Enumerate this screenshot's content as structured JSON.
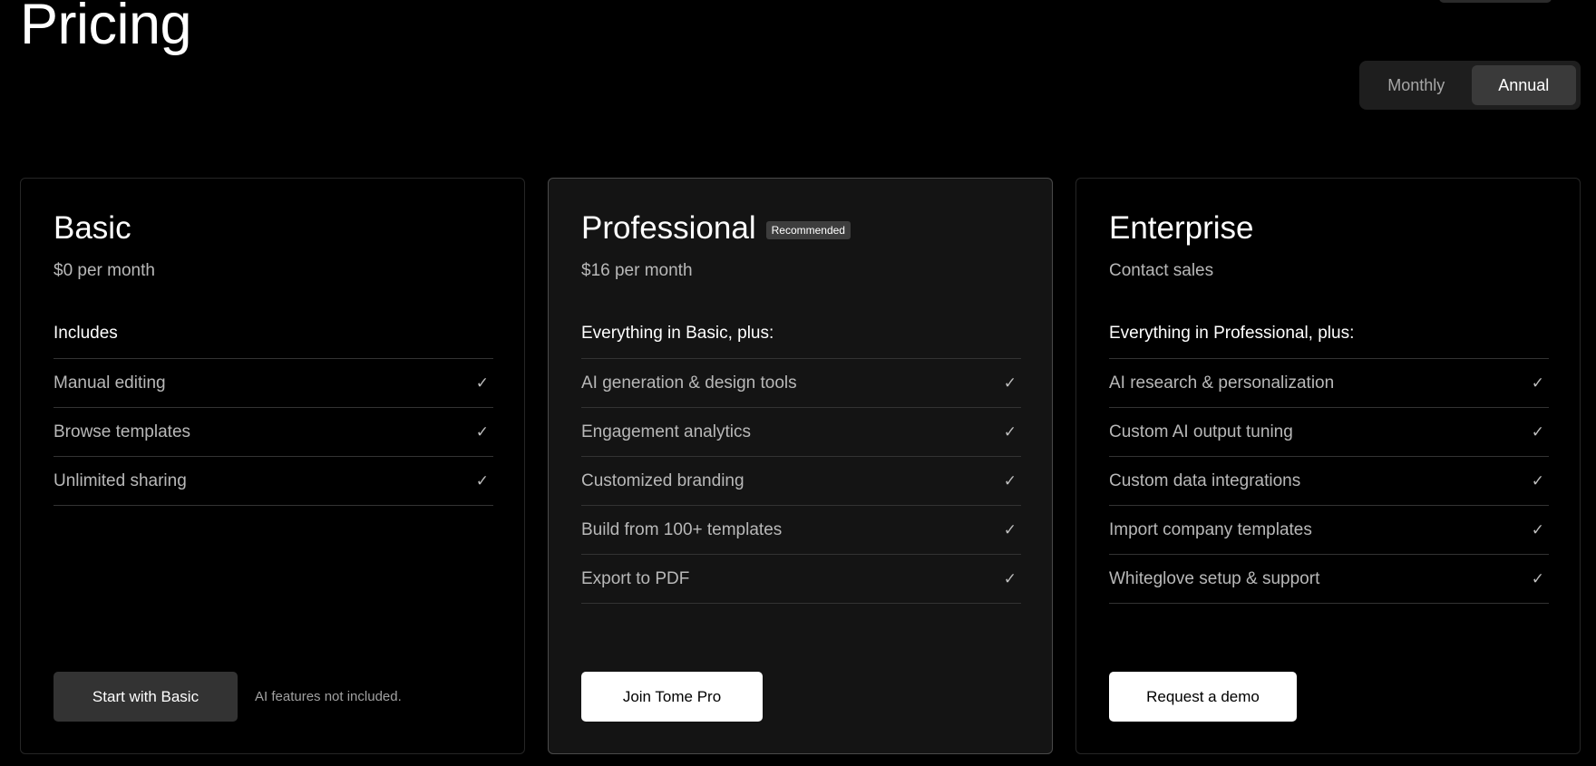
{
  "page": {
    "title": "Pricing"
  },
  "billing_toggle": {
    "options": [
      {
        "label": "Monthly",
        "active": false
      },
      {
        "label": "Annual",
        "active": true
      }
    ]
  },
  "plans": [
    {
      "name": "Basic",
      "price": "$0 per month",
      "features_heading": "Includes",
      "features": [
        "Manual editing",
        "Browse templates",
        "Unlimited sharing"
      ],
      "cta_label": "Start with Basic",
      "cta_note": "AI features not included."
    },
    {
      "name": "Professional",
      "badge": "Recommended",
      "price": "$16 per month",
      "features_heading": "Everything in Basic, plus:",
      "features": [
        "AI generation & design tools",
        "Engagement analytics",
        "Customized branding",
        "Build from 100+ templates",
        "Export to PDF"
      ],
      "cta_label": "Join Tome Pro"
    },
    {
      "name": "Enterprise",
      "price": "Contact sales",
      "features_heading": "Everything in Professional, plus:",
      "features": [
        "AI research & personalization",
        "Custom AI output tuning",
        "Custom data integrations",
        "Import company templates",
        "Whiteglove setup & support"
      ],
      "cta_label": "Request a demo"
    }
  ],
  "icons": {
    "check": "✓"
  },
  "colors": {
    "background": "#000000",
    "card_highlight": "#141414",
    "muted_text": "#b8b8b8",
    "primary_button": "#ffffff",
    "secondary_button": "#333333"
  }
}
